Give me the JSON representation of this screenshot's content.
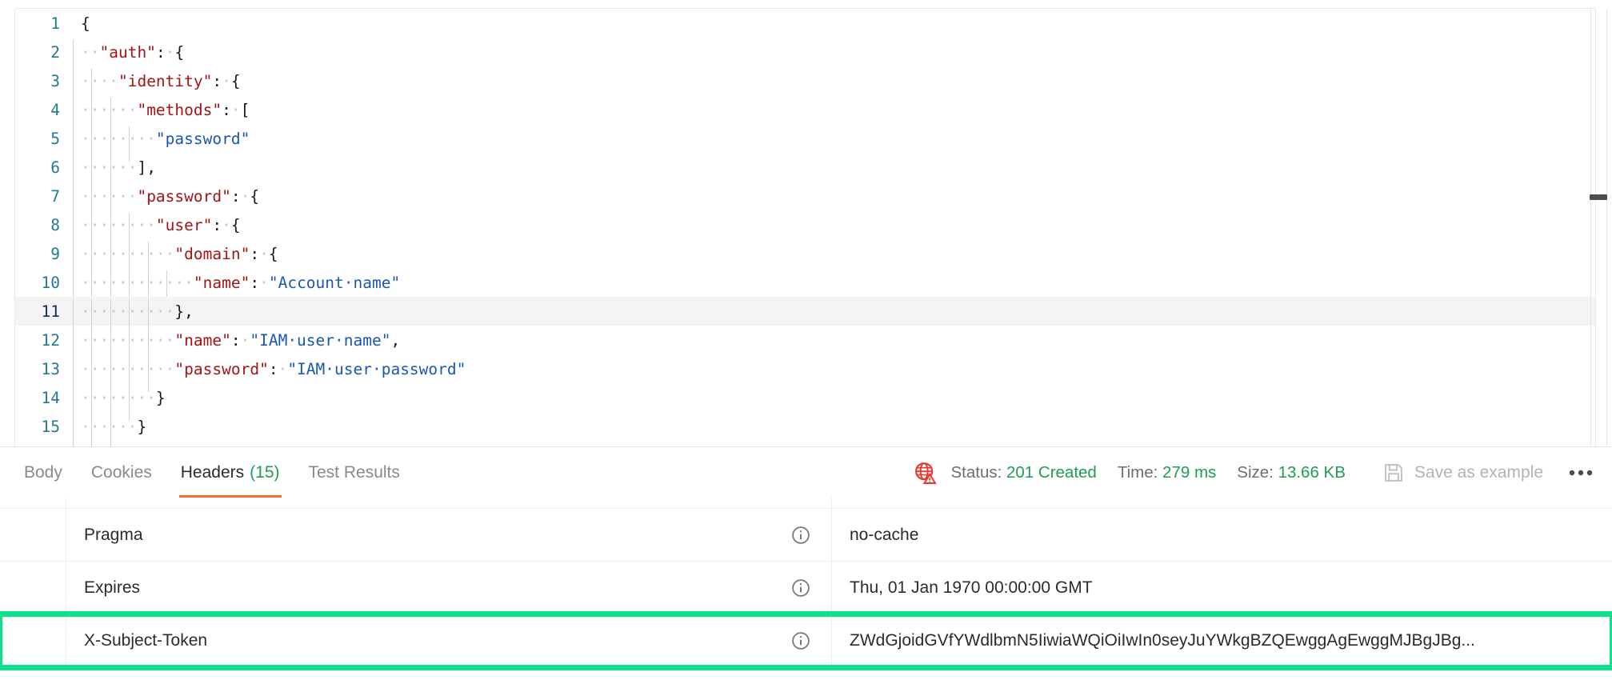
{
  "editor": {
    "language": "json",
    "active_line": 11,
    "lines": [
      {
        "num": "1",
        "indent": 0,
        "tokens": [
          {
            "t": "p",
            "v": "{"
          }
        ]
      },
      {
        "num": "2",
        "indent": 1,
        "tokens": [
          {
            "t": "ws",
            "v": "··"
          },
          {
            "t": "k",
            "v": "\"auth\""
          },
          {
            "t": "p",
            "v": ":"
          },
          {
            "t": "ws",
            "v": "·"
          },
          {
            "t": "p",
            "v": "{"
          }
        ]
      },
      {
        "num": "3",
        "indent": 2,
        "tokens": [
          {
            "t": "ws",
            "v": "····"
          },
          {
            "t": "k",
            "v": "\"identity\""
          },
          {
            "t": "p",
            "v": ":"
          },
          {
            "t": "ws",
            "v": "·"
          },
          {
            "t": "p",
            "v": "{"
          }
        ]
      },
      {
        "num": "4",
        "indent": 3,
        "tokens": [
          {
            "t": "ws",
            "v": "······"
          },
          {
            "t": "k",
            "v": "\"methods\""
          },
          {
            "t": "p",
            "v": ":"
          },
          {
            "t": "ws",
            "v": "·"
          },
          {
            "t": "p",
            "v": "["
          }
        ]
      },
      {
        "num": "5",
        "indent": 4,
        "tokens": [
          {
            "t": "ws",
            "v": "········"
          },
          {
            "t": "s",
            "v": "\"password\""
          }
        ]
      },
      {
        "num": "6",
        "indent": 3,
        "tokens": [
          {
            "t": "ws",
            "v": "······"
          },
          {
            "t": "p",
            "v": "],"
          }
        ]
      },
      {
        "num": "7",
        "indent": 3,
        "tokens": [
          {
            "t": "ws",
            "v": "······"
          },
          {
            "t": "k",
            "v": "\"password\""
          },
          {
            "t": "p",
            "v": ":"
          },
          {
            "t": "ws",
            "v": "·"
          },
          {
            "t": "p",
            "v": "{"
          }
        ]
      },
      {
        "num": "8",
        "indent": 4,
        "tokens": [
          {
            "t": "ws",
            "v": "········"
          },
          {
            "t": "k",
            "v": "\"user\""
          },
          {
            "t": "p",
            "v": ":"
          },
          {
            "t": "ws",
            "v": "·"
          },
          {
            "t": "p",
            "v": "{"
          }
        ]
      },
      {
        "num": "9",
        "indent": 5,
        "tokens": [
          {
            "t": "ws",
            "v": "··········"
          },
          {
            "t": "k",
            "v": "\"domain\""
          },
          {
            "t": "p",
            "v": ":"
          },
          {
            "t": "ws",
            "v": "·"
          },
          {
            "t": "p",
            "v": "{"
          }
        ]
      },
      {
        "num": "10",
        "indent": 6,
        "tokens": [
          {
            "t": "ws",
            "v": "············"
          },
          {
            "t": "k",
            "v": "\"name\""
          },
          {
            "t": "p",
            "v": ":"
          },
          {
            "t": "ws",
            "v": "·"
          },
          {
            "t": "s",
            "v": "\"Account·name\""
          }
        ]
      },
      {
        "num": "11",
        "indent": 5,
        "tokens": [
          {
            "t": "ws",
            "v": "··········"
          },
          {
            "t": "p",
            "v": "},"
          }
        ]
      },
      {
        "num": "12",
        "indent": 5,
        "tokens": [
          {
            "t": "ws",
            "v": "··········"
          },
          {
            "t": "k",
            "v": "\"name\""
          },
          {
            "t": "p",
            "v": ":"
          },
          {
            "t": "ws",
            "v": "·"
          },
          {
            "t": "s",
            "v": "\"IAM·user·name\""
          },
          {
            "t": "p",
            "v": ","
          }
        ]
      },
      {
        "num": "13",
        "indent": 5,
        "tokens": [
          {
            "t": "ws",
            "v": "··········"
          },
          {
            "t": "k",
            "v": "\"password\""
          },
          {
            "t": "p",
            "v": ":"
          },
          {
            "t": "ws",
            "v": "·"
          },
          {
            "t": "s",
            "v": "\"IAM·user·password\""
          }
        ]
      },
      {
        "num": "14",
        "indent": 4,
        "tokens": [
          {
            "t": "ws",
            "v": "········"
          },
          {
            "t": "p",
            "v": "}"
          }
        ]
      },
      {
        "num": "15",
        "indent": 3,
        "tokens": [
          {
            "t": "ws",
            "v": "······"
          },
          {
            "t": "p",
            "v": "}"
          }
        ]
      }
    ]
  },
  "response_bar": {
    "tabs": [
      {
        "label": "Body",
        "count": "",
        "active": false
      },
      {
        "label": "Cookies",
        "count": "",
        "active": false
      },
      {
        "label": "Headers",
        "count": "(15)",
        "active": true
      },
      {
        "label": "Test Results",
        "count": "",
        "active": false
      }
    ],
    "warning_icon": "globe-warning-icon",
    "stats": [
      {
        "label": "Status:",
        "value": "201 Created"
      },
      {
        "label": "Time:",
        "value": "279 ms"
      },
      {
        "label": "Size:",
        "value": "13.66 KB"
      }
    ],
    "save_as_example_label": "Save as example",
    "save_icon": "save-floppy-icon",
    "more_menu_label": "●●●"
  },
  "headers_table": {
    "info_icon": "info-circle-icon",
    "rows": [
      {
        "key": "Pragma",
        "value": "no-cache",
        "highlighted": false
      },
      {
        "key": "Expires",
        "value": "Thu, 01 Jan 1970 00:00:00 GMT",
        "highlighted": false
      },
      {
        "key": "X-Subject-Token",
        "value": "ZWdGjoidGVfYWdlbmN5IiwiaWQiOiIwIn0seyJuYWkgBZQEwggAgEwggMJBgJBg...",
        "highlighted": true
      }
    ]
  },
  "colors": {
    "accent_orange": "#f26b3a",
    "status_green": "#1f9d55",
    "highlight_green": "#0fe08c",
    "json_key_red": "#a31515",
    "json_string_blue": "#1a57b5",
    "gutter_teal": "#237893"
  }
}
